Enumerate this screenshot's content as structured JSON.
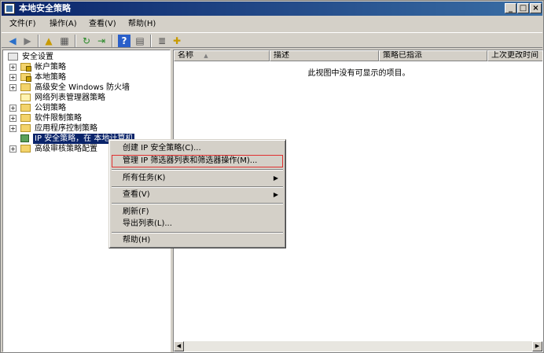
{
  "window": {
    "title": "本地安全策略"
  },
  "menubar": {
    "items": [
      "文件(F)",
      "操作(A)",
      "查看(V)",
      "帮助(H)"
    ]
  },
  "toolbar": {
    "icons": [
      "back-arrow-icon",
      "forward-arrow-icon",
      "up-folder-icon",
      "show-tree-icon",
      "refresh-icon",
      "export-list-icon",
      "help-icon",
      "properties-icon",
      "manage-filters-icon",
      "add-policy-icon"
    ]
  },
  "tree": {
    "root": "安全设置",
    "items": [
      {
        "label": "帐户策略",
        "expandable": true
      },
      {
        "label": "本地策略",
        "expandable": true
      },
      {
        "label": "高级安全 Windows 防火墙",
        "expandable": true
      },
      {
        "label": "网络列表管理器策略",
        "expandable": false
      },
      {
        "label": "公钥策略",
        "expandable": true
      },
      {
        "label": "软件限制策略",
        "expandable": true
      },
      {
        "label": "应用程序控制策略",
        "expandable": true
      },
      {
        "label": "IP 安全策略，在 本地计算机",
        "expandable": false,
        "selected": true
      },
      {
        "label": "高级审核策略配置",
        "expandable": true
      }
    ]
  },
  "list": {
    "columns": [
      "名称",
      "描述",
      "策略已指派",
      "上次更改时间"
    ],
    "empty_message": "此视图中没有可显示的项目。"
  },
  "context_menu": {
    "items": [
      "创建 IP 安全策略(C)...",
      "管理 IP 筛选器列表和筛选器操作(M)...",
      "所有任务(K)",
      "查看(V)",
      "刷新(F)",
      "导出列表(L)...",
      "帮助(H)"
    ]
  },
  "colors": {
    "titlebar_start": "#0a246a",
    "titlebar_end": "#3a6ea5",
    "selection": "#0a246a",
    "highlight_outline": "#e03030"
  }
}
